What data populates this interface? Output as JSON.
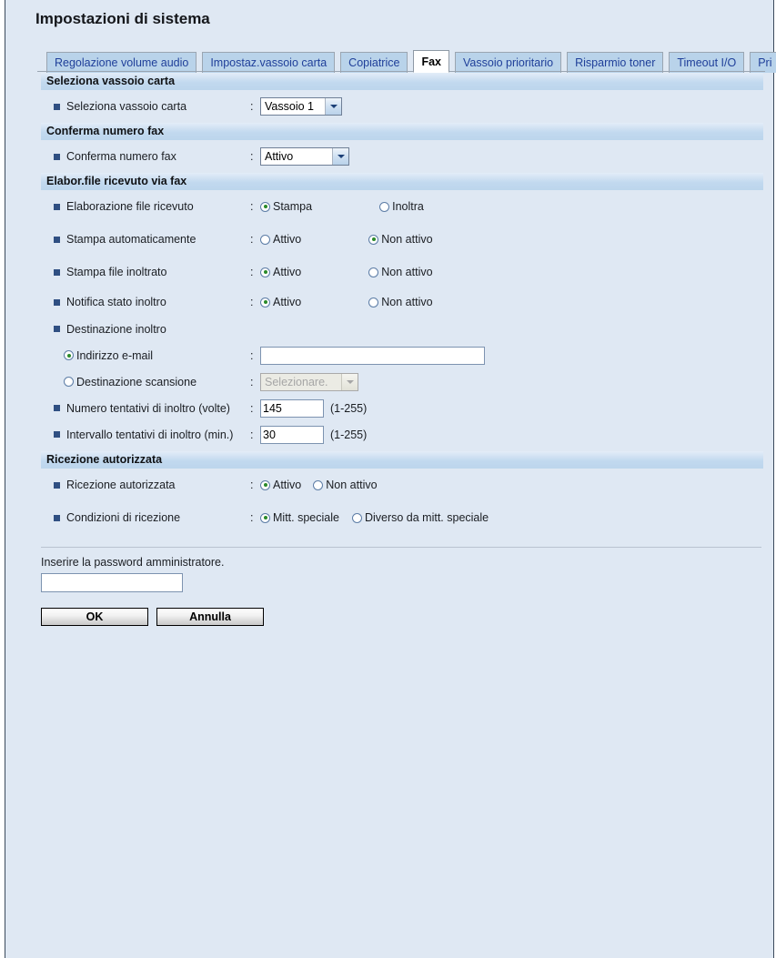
{
  "header": {
    "title": "Impostazioni di sistema"
  },
  "tabs": [
    {
      "label": "Regolazione volume audio",
      "active": false
    },
    {
      "label": "Impostaz.vassoio carta",
      "active": false
    },
    {
      "label": "Copiatrice",
      "active": false
    },
    {
      "label": "Fax",
      "active": true
    },
    {
      "label": "Vassoio prioritario",
      "active": false
    },
    {
      "label": "Risparmio toner",
      "active": false
    },
    {
      "label": "Timeout I/O",
      "active": false
    },
    {
      "label": "Pri",
      "active": false
    }
  ],
  "sections": {
    "tray": {
      "heading": "Seleziona vassoio carta",
      "row_label": "Seleziona vassoio carta",
      "colon": ":",
      "value": "Vassoio 1"
    },
    "confirm": {
      "heading": "Conferma numero fax",
      "row_label": "Conferma numero fax",
      "colon": ":",
      "value": "Attivo"
    },
    "received": {
      "heading": "Elabor.file ricevuto via fax",
      "colon": ":",
      "rows": [
        {
          "label": "Elaborazione file ricevuto",
          "opt1": "Stampa",
          "opt2": "Inoltra",
          "selected": 1
        },
        {
          "label": "Stampa automaticamente",
          "opt1": "Attivo",
          "opt2": "Non attivo",
          "selected": 2
        },
        {
          "label": "Stampa file inoltrato",
          "opt1": "Attivo",
          "opt2": "Non attivo",
          "selected": 1
        },
        {
          "label": "Notifica stato inoltro",
          "opt1": "Attivo",
          "opt2": "Non attivo",
          "selected": 1
        }
      ],
      "destination_label": "Destinazione inoltro",
      "email_option": "Indirizzo e-mail",
      "email_value": "",
      "scan_option": "Destinazione scansione",
      "scan_value": "Selezionare.",
      "attempts_label": "Numero tentativi di inoltro (volte)",
      "attempts_value": "145",
      "attempts_hint": "(1-255)",
      "interval_label": "Intervallo tentativi di inoltro (min.)",
      "interval_value": "30",
      "interval_hint": "(1-255)"
    },
    "authorized": {
      "heading": "Ricezione autorizzata",
      "colon": ":",
      "rows": [
        {
          "label": "Ricezione autorizzata",
          "opt1": "Attivo",
          "opt2": "Non attivo",
          "selected": 1
        },
        {
          "label": "Condizioni di ricezione",
          "opt1": "Mitt. speciale",
          "opt2": "Diverso da mitt. speciale",
          "selected": 1
        }
      ]
    }
  },
  "footer": {
    "password_label": "Inserire la password amministratore.",
    "password_value": "",
    "ok_label": "OK",
    "cancel_label": "Annulla"
  },
  "colors": {
    "page_background": "#dfe8f3",
    "tab_inactive": "#b9d3ea",
    "tab_text": "#20409a",
    "section_band": "#c2d9ef",
    "bullet": "#2f4f82",
    "radio_selected_dot": "#2a8a2a"
  }
}
